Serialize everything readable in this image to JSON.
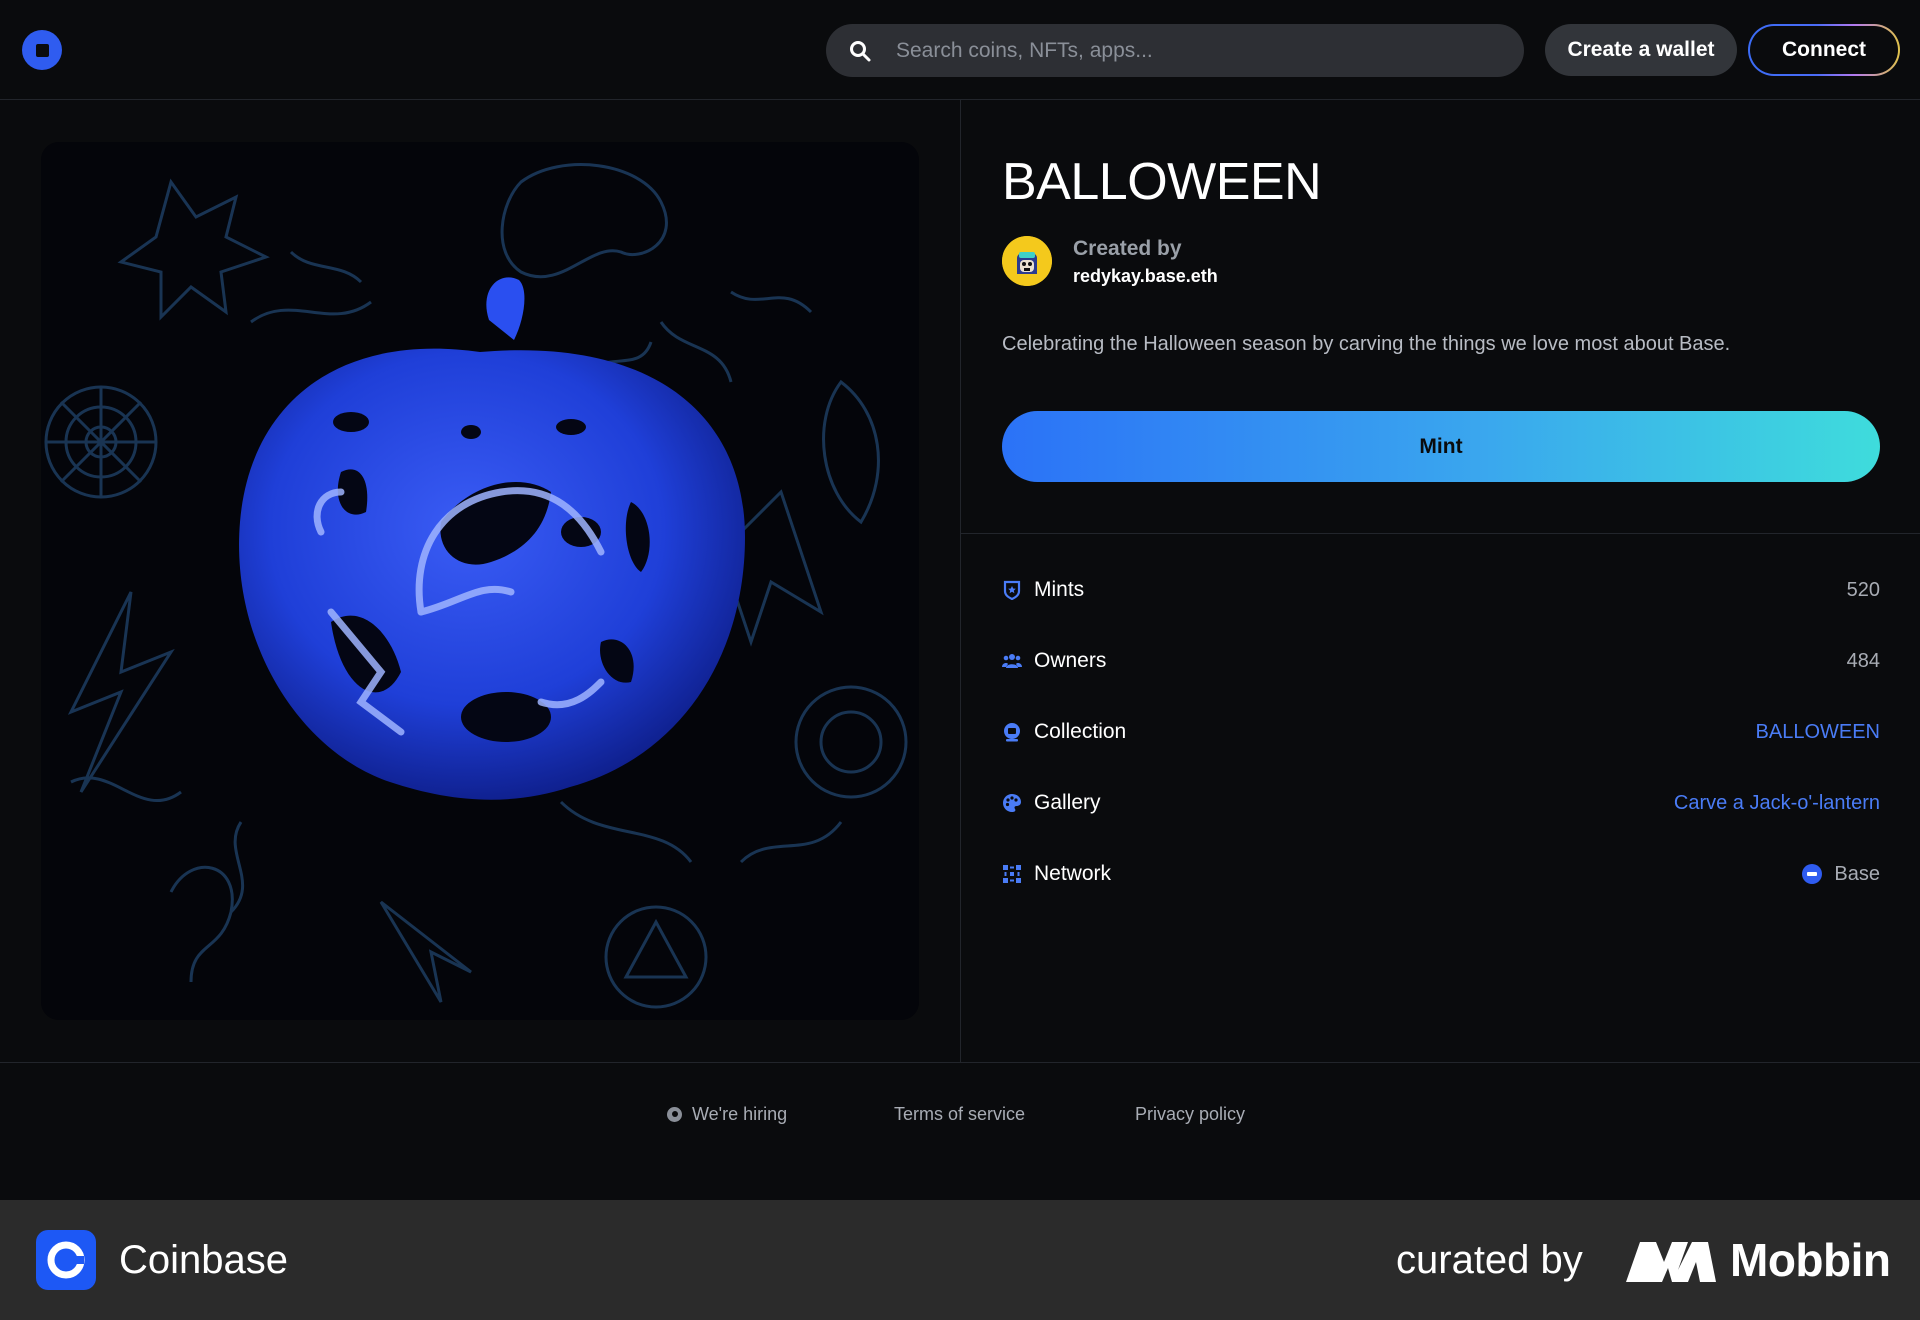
{
  "header": {
    "search_placeholder": "Search coins, NFTs, apps...",
    "create_wallet_label": "Create a wallet",
    "connect_label": "Connect"
  },
  "nft": {
    "title": "BALLOWEEN",
    "created_by_label": "Created by",
    "creator": "redykay.base.eth",
    "description": "Celebrating the Halloween season by carving the things we love most about Base.",
    "mint_label": "Mint"
  },
  "details": [
    {
      "label": "Mints",
      "value": "520",
      "icon": "shield-icon"
    },
    {
      "label": "Owners",
      "value": "484",
      "icon": "people-icon"
    },
    {
      "label": "Collection",
      "value": "BALLOWEEN",
      "icon": "collection-icon"
    },
    {
      "label": "Gallery",
      "value": "Carve a Jack-o'-lantern",
      "icon": "palette-icon"
    },
    {
      "label": "Network",
      "value": "Base",
      "icon": "network-icon"
    }
  ],
  "footer": {
    "hiring": "We're hiring",
    "terms": "Terms of service",
    "privacy": "Privacy policy"
  },
  "attribution": {
    "app_name": "Coinbase",
    "curated_by": "curated by",
    "brand": "Mobbin"
  },
  "colors": {
    "background": "#0a0b0d",
    "accent": "#2f5cf0",
    "link": "#4a7cf6",
    "mint_gradient_start": "#2b72f7",
    "mint_gradient_end": "#3edcdc"
  }
}
